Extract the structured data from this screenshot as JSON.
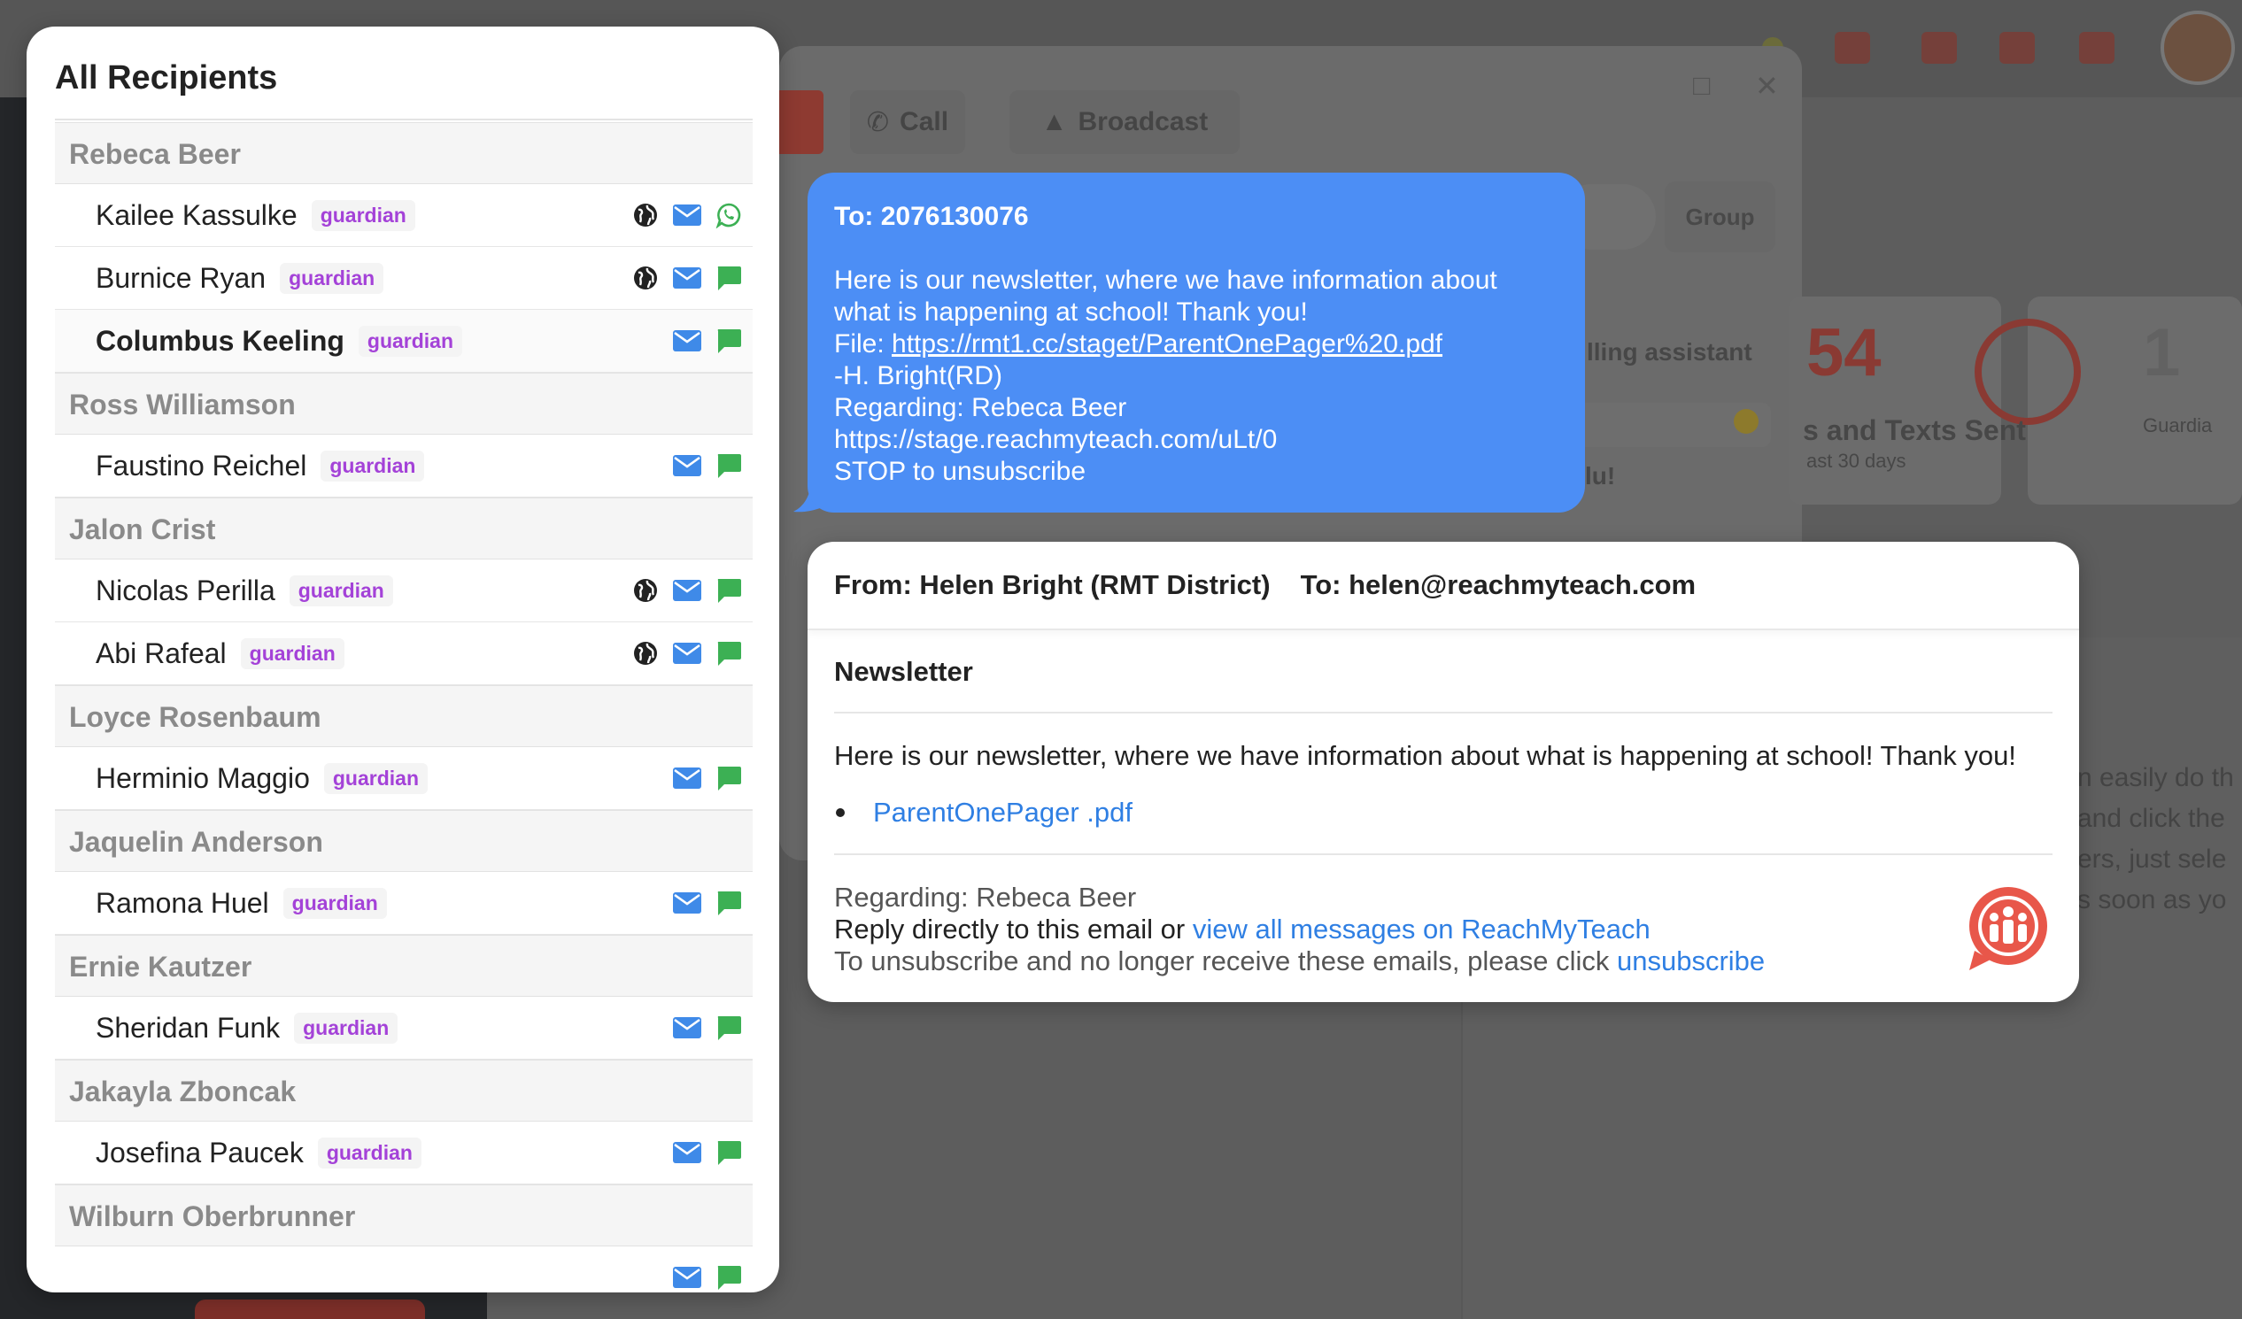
{
  "background": {
    "tabs": [
      {
        "label": "Call",
        "icon": "phone-icon"
      },
      {
        "label": "Broadcast",
        "icon": "megaphone-icon"
      }
    ],
    "group_button": "Group",
    "assistant_label": "lling assistant",
    "stat_big": "54",
    "stat_label": "s and Texts Sent",
    "stat_sub": "ast 30 days",
    "stat_one": "1",
    "stat_one_label": "Guardia",
    "snippet": "lu!",
    "right_lines": [
      "n easily do th",
      "and click the",
      "ers, just sele",
      "s soon as yo"
    ]
  },
  "recipients": {
    "title": "All Recipients",
    "groups": [
      {
        "student": "Rebeca Beer",
        "guardians": [
          {
            "name": "Kailee Kassulke",
            "role": "guardian",
            "icons": [
              "globe-icon",
              "email-icon",
              "whatsapp-icon"
            ]
          },
          {
            "name": "Burnice Ryan",
            "role": "guardian",
            "icons": [
              "globe-icon",
              "email-icon",
              "sms-icon"
            ]
          },
          {
            "name": "Columbus Keeling",
            "role": "guardian",
            "icons": [
              "email-icon",
              "sms-icon"
            ],
            "selected": true
          }
        ]
      },
      {
        "student": "Ross Williamson",
        "guardians": [
          {
            "name": "Faustino Reichel",
            "role": "guardian",
            "icons": [
              "email-icon",
              "sms-icon"
            ]
          }
        ]
      },
      {
        "student": "Jalon Crist",
        "guardians": [
          {
            "name": "Nicolas Perilla",
            "role": "guardian",
            "icons": [
              "globe-icon",
              "email-icon",
              "sms-icon"
            ]
          },
          {
            "name": "Abi Rafeal",
            "role": "guardian",
            "icons": [
              "globe-icon",
              "email-icon",
              "sms-icon"
            ]
          }
        ]
      },
      {
        "student": "Loyce Rosenbaum",
        "guardians": [
          {
            "name": "Herminio Maggio",
            "role": "guardian",
            "icons": [
              "email-icon",
              "sms-icon"
            ]
          }
        ]
      },
      {
        "student": "Jaquelin Anderson",
        "guardians": [
          {
            "name": "Ramona Huel",
            "role": "guardian",
            "icons": [
              "email-icon",
              "sms-icon"
            ]
          }
        ]
      },
      {
        "student": "Ernie Kautzer",
        "guardians": [
          {
            "name": "Sheridan Funk",
            "role": "guardian",
            "icons": [
              "email-icon",
              "sms-icon"
            ]
          }
        ]
      },
      {
        "student": "Jakayla Zboncak",
        "guardians": [
          {
            "name": "Josefina Paucek",
            "role": "guardian",
            "icons": [
              "email-icon",
              "sms-icon"
            ]
          }
        ]
      },
      {
        "student": "Wilburn Oberbrunner",
        "guardians": [
          {
            "name": "",
            "role": "",
            "icons": [
              "email-icon",
              "sms-icon"
            ]
          }
        ]
      }
    ]
  },
  "sms": {
    "to": "To: 2076130076",
    "line1": "Here is our newsletter, where we have information about",
    "line2": "what is happening at school! Thank you!",
    "file_prefix": "File: ",
    "file_link": "https://rmt1.cc/staget/ParentOnePager%20.pdf",
    "signature": "-H. Bright(RD)",
    "regarding": "Regarding: Rebeca Beer",
    "short_link": "https://stage.reachmyteach.com/uLt/0",
    "stop": "STOP to unsubscribe"
  },
  "email": {
    "from": "From: Helen Bright (RMT District)",
    "to": "To: helen@reachmyteach.com",
    "subject": "Newsletter",
    "body": "Here is our newsletter, where we have information about what is happening at school! Thank you!",
    "attachment": "ParentOnePager .pdf",
    "regarding": "Regarding: Rebeca Beer",
    "reply_prefix": "Reply directly to this email or ",
    "reply_link": "view all messages on ReachMyTeach",
    "unsub_prefix": "To unsubscribe and no longer receive these emails, please click ",
    "unsub_link": "unsubscribe",
    "logo_icon": "reachmyteach-logo-icon"
  },
  "colors": {
    "sms_bubble": "#4c8ef5",
    "link": "#2f7fe3",
    "badge": "#a442d8",
    "email_icon": "#3f8ae8",
    "sms_icon": "#3cb054",
    "brand": "#e8574a"
  }
}
